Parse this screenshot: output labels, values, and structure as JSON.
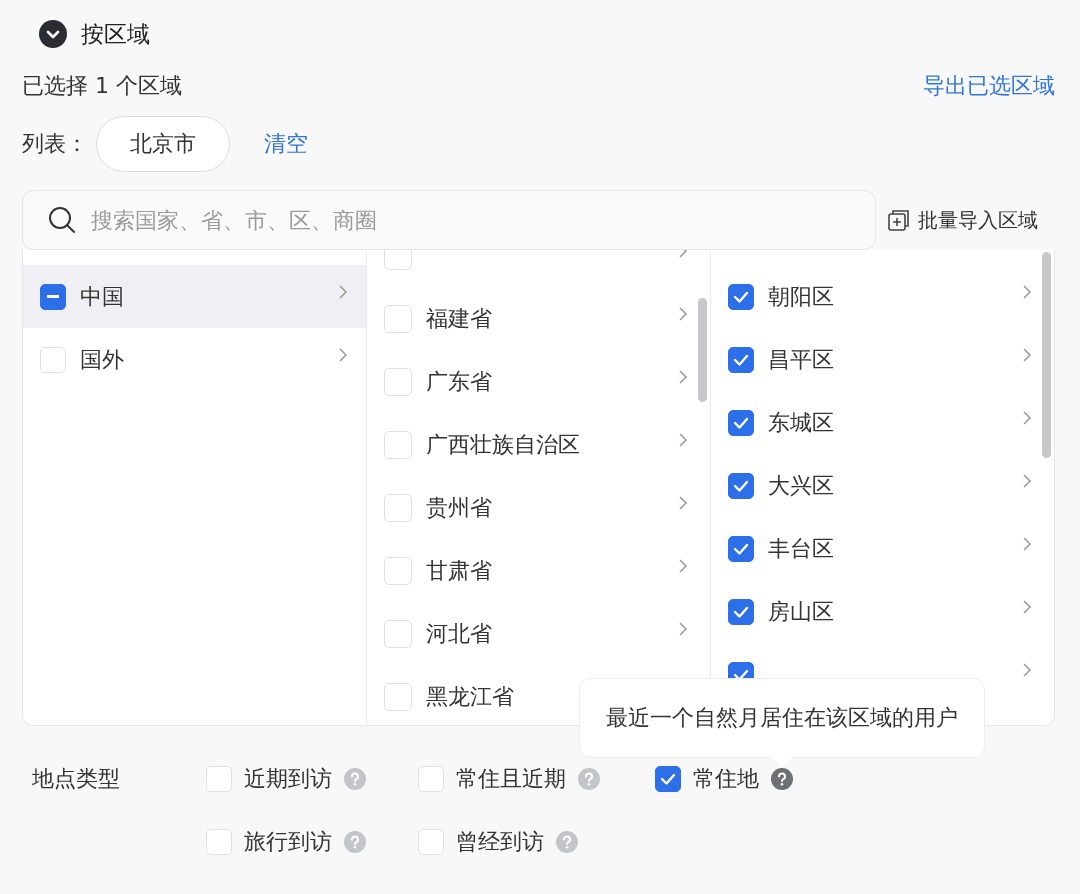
{
  "section": {
    "title": "按区域",
    "expanded": true
  },
  "summary": "已选择 1 个区域",
  "export_link": "导出已选区域",
  "list": {
    "label": "列表：",
    "tags": [
      "北京市"
    ],
    "clear": "清空"
  },
  "search": {
    "placeholder": "搜索国家、省、市、区、商圈"
  },
  "batch_import": "批量导入区域",
  "countries": [
    {
      "label": "中国",
      "indeterminate": true,
      "selected": true
    },
    {
      "label": "国外",
      "indeterminate": false,
      "selected": false
    }
  ],
  "provinces": [
    {
      "checked": false
    },
    {
      "label": "福建省",
      "checked": false
    },
    {
      "label": "广东省",
      "checked": false
    },
    {
      "label": "广西壮族自治区",
      "checked": false
    },
    {
      "label": "贵州省",
      "checked": false
    },
    {
      "label": "甘肃省",
      "checked": false
    },
    {
      "label": "河北省",
      "checked": false
    },
    {
      "label": "黑龙江省",
      "checked": false
    }
  ],
  "districts": [
    {
      "label": "朝阳区",
      "checked": true
    },
    {
      "label": "昌平区",
      "checked": true
    },
    {
      "label": "东城区",
      "checked": true
    },
    {
      "label": "大兴区",
      "checked": true
    },
    {
      "label": "丰台区",
      "checked": true
    },
    {
      "label": "房山区",
      "checked": true
    },
    {
      "checked": true
    }
  ],
  "location_type": {
    "label": "地点类型",
    "options": [
      {
        "label": "近期到访",
        "checked": false
      },
      {
        "label": "常住且近期",
        "checked": false
      },
      {
        "label": "常住地",
        "checked": true,
        "tooltip": "最近一个自然月居住在该区域的用户"
      },
      {
        "label": "旅行到访",
        "checked": false
      },
      {
        "label": "曾经到访",
        "checked": false
      }
    ]
  }
}
